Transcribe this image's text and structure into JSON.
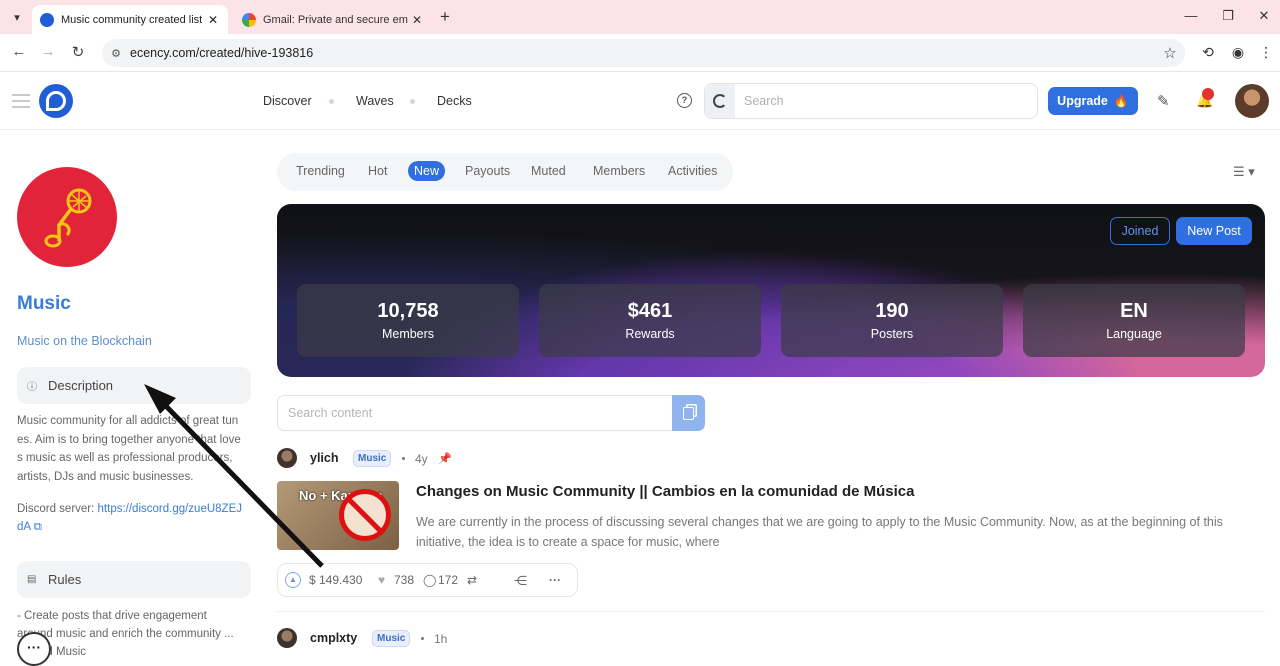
{
  "browser": {
    "tabs": [
      {
        "title": "Music community created list",
        "close": "✕"
      },
      {
        "title": "Gmail: Private and secure email",
        "close": "✕"
      }
    ],
    "new_tab": "+",
    "address": "ecency.com/created/hive-193816"
  },
  "header": {
    "nav": [
      "Discover",
      "Waves",
      "Decks"
    ],
    "search_placeholder": "Search",
    "upgrade_label": "Upgrade"
  },
  "sidebar": {
    "community_name": "Music",
    "tagline": "Music on the Blockchain",
    "description_title": "Description",
    "description_text": "Music community for all addicts of great tunes. Aim is to bring together anyone that loves music as well as professional producers, artists, DJs and music businesses.",
    "discord_label": "Discord server: ",
    "discord_url": "https://discord.gg/zueU8ZEJdA",
    "rules_title": "Rules",
    "rules_text": "- Create posts that drive engagement around music and enrich the community ... around Music"
  },
  "tabs": [
    "Trending",
    "Hot",
    "New",
    "Payouts",
    "Muted",
    "Members",
    "Activities"
  ],
  "active_tab": "New",
  "banner": {
    "joined_label": "Joined",
    "new_post_label": "New Post",
    "stats": [
      {
        "value": "10,758",
        "label": "Members"
      },
      {
        "value": "$461",
        "label": "Rewards"
      },
      {
        "value": "190",
        "label": "Posters"
      },
      {
        "value": "EN",
        "label": "Language"
      }
    ]
  },
  "content_search_placeholder": "Search content",
  "posts": [
    {
      "author": "ylich",
      "category": "Music",
      "age": "4y",
      "pinned": true,
      "thumb_text": "No + Karaoke",
      "title": "Changes on Music Community || Cambios en la comunidad de Música",
      "excerpt": "We are currently in the process of discussing several changes that we are going to apply to the Music Community. Now, as at the beginning of this initiative, the idea is to create a space for music, where",
      "payout": "$ 149.430",
      "votes": "738",
      "comments": "172"
    },
    {
      "author": "cmplxty",
      "category": "Music",
      "age": "1h"
    }
  ],
  "colors": {
    "accent": "#2f6fdf",
    "community": "#e2243a",
    "tab_strip": "#fbe3e8"
  }
}
